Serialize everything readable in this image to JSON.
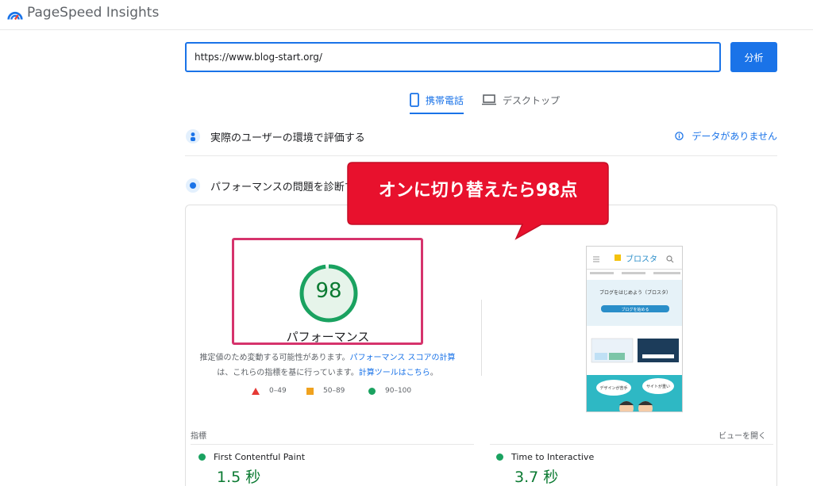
{
  "app": {
    "title": "PageSpeed Insights"
  },
  "search": {
    "value": "https://www.blog-start.org/",
    "button_label": "分析"
  },
  "tabs": {
    "mobile": "携帯電話",
    "desktop": "デスクトップ"
  },
  "field_data": {
    "title": "実際のユーザーの環境で評価する",
    "no_data": "データがありません"
  },
  "lab_data": {
    "title": "パフォーマンスの問題を診断す"
  },
  "callout": {
    "text": "オンに切り替えたら98点"
  },
  "gauge": {
    "score": "98",
    "score_fraction": 0.98,
    "label": "パフォーマンス",
    "color": "#1aa260"
  },
  "note": {
    "prefix": "推定値のため変動する可能性があります。",
    "link1": "パフォーマンス スコアの計算",
    "middle": "は、これらの指標を基に行っています。",
    "link2": "計算ツールはこちら",
    "suffix": "。"
  },
  "legend": {
    "red": "0–49",
    "orange": "50–89",
    "green": "90–100"
  },
  "preview": {
    "site_name": "ブロスタ",
    "nav": [
      "ホーム",
      "ブログ始め方",
      "サイト作成"
    ],
    "hero_title": "ブログをはじめよう（ブロスタ）",
    "hero_button": "ブログを始める",
    "bubble1": "デザインが苦手",
    "bubble2": "サイトが重い"
  },
  "metrics": {
    "label": "指標",
    "open_view": "ビューを開く",
    "items": [
      {
        "name": "First Contentful Paint",
        "value": "1.5 秒"
      },
      {
        "name": "Time to Interactive",
        "value": "3.7 秒"
      }
    ]
  },
  "colors": {
    "accent": "#1a73e8",
    "good": "#1aa260",
    "callout": "#e8112d"
  }
}
